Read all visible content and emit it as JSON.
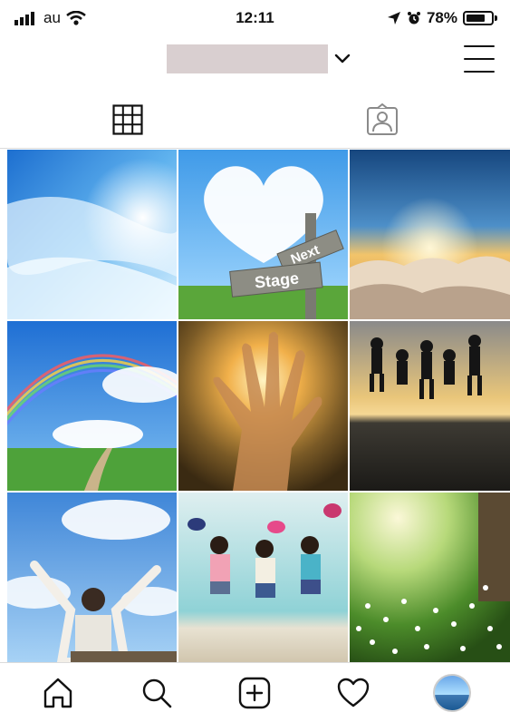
{
  "status_bar": {
    "carrier": "au",
    "time": "12:11",
    "battery_percent": "78%",
    "battery_level": 0.78,
    "icons": [
      "signal-icon",
      "wifi-icon",
      "location-arrow-icon",
      "alarm-icon",
      "battery-icon"
    ]
  },
  "header": {
    "username_redacted": true,
    "icons": [
      "chevron-down-icon",
      "hamburger-menu-icon"
    ]
  },
  "view_tabs": [
    {
      "name": "grid",
      "icon": "grid-icon",
      "selected": true
    },
    {
      "name": "tagged",
      "icon": "tagged-person-icon",
      "selected": false
    }
  ],
  "posts": [
    {
      "id": "post-1",
      "scene": "blue sky with clouds and sun",
      "overlay_text": ""
    },
    {
      "id": "post-2",
      "scene": "heart-shaped cloud with signpost",
      "overlay_text": "Next Stage"
    },
    {
      "id": "post-3",
      "scene": "sunset above clouds",
      "overlay_text": ""
    },
    {
      "id": "post-4",
      "scene": "rainbow over green field and path",
      "overlay_text": ""
    },
    {
      "id": "post-5",
      "scene": "hand reaching toward sunlight",
      "overlay_text": ""
    },
    {
      "id": "post-6",
      "scene": "silhouettes jumping on beach at sunset",
      "overlay_text": ""
    },
    {
      "id": "post-7",
      "scene": "person raising arms under blue sky",
      "overlay_text": ""
    },
    {
      "id": "post-8",
      "scene": "three girls jumping on beach",
      "overlay_text": ""
    },
    {
      "id": "post-9",
      "scene": "white flowers in sunlit grass",
      "overlay_text": ""
    }
  ],
  "sign_words": {
    "next": "Next",
    "stage": "Stage"
  },
  "tab_bar": [
    {
      "name": "home",
      "icon": "home-icon"
    },
    {
      "name": "search",
      "icon": "search-icon"
    },
    {
      "name": "new-post",
      "icon": "add-post-icon"
    },
    {
      "name": "activity",
      "icon": "heart-icon"
    },
    {
      "name": "profile",
      "icon": "profile-avatar"
    }
  ],
  "colors": {
    "divider": "#dbdbdb",
    "redaction": "#d9cfd0",
    "icon": "#111111"
  }
}
